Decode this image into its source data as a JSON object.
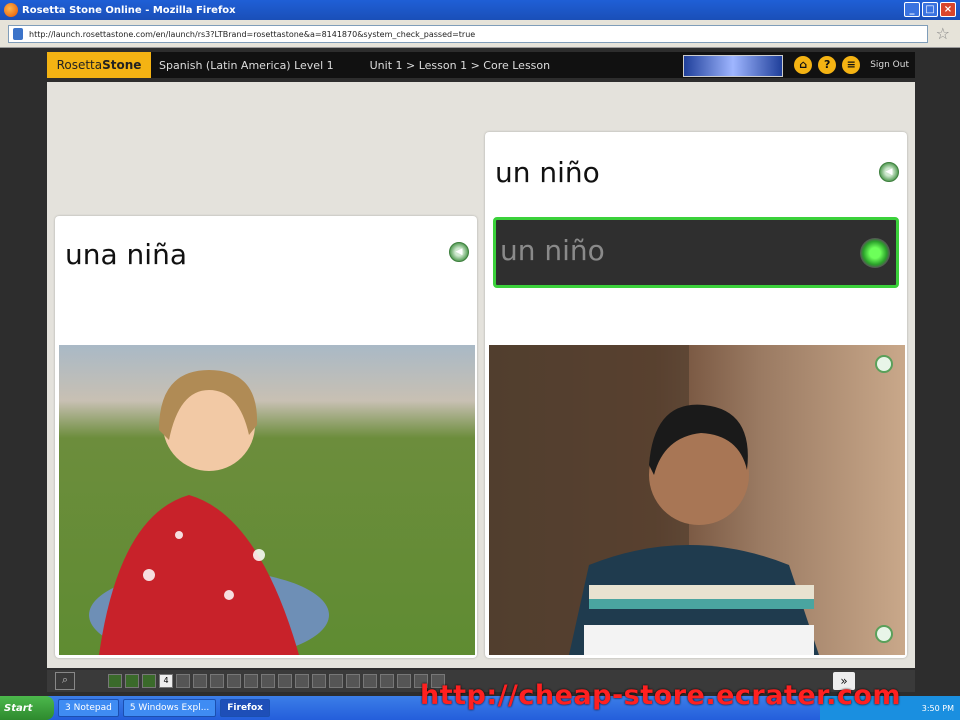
{
  "window": {
    "title": "Rosetta Stone Online - Mozilla Firefox"
  },
  "browser": {
    "url": "http://launch.rosettastone.com/en/launch/rs3?LTBrand=rosettastone&a=8141870&system_check_passed=true"
  },
  "app": {
    "logo_part1": "Rosetta",
    "logo_part2": "Stone",
    "course": "Spanish (Latin America) Level 1",
    "breadcrumb": "Unit 1 > Lesson 1 > Core Lesson",
    "sign_out": "Sign Out"
  },
  "cards": {
    "left_label": "una niña",
    "right_label": "un niño",
    "answer_text": "un niño"
  },
  "progress": {
    "current_step": "4"
  },
  "taskbar": {
    "start": "Start",
    "tasks": [
      "3 Notepad",
      "5 Windows Expl...",
      "Firefox"
    ],
    "clock": "3:50 PM"
  },
  "watermark": "http://cheap-store.ecrater.com",
  "colors": {
    "brand": "#f4b313",
    "correct_green": "#3bd13b"
  }
}
